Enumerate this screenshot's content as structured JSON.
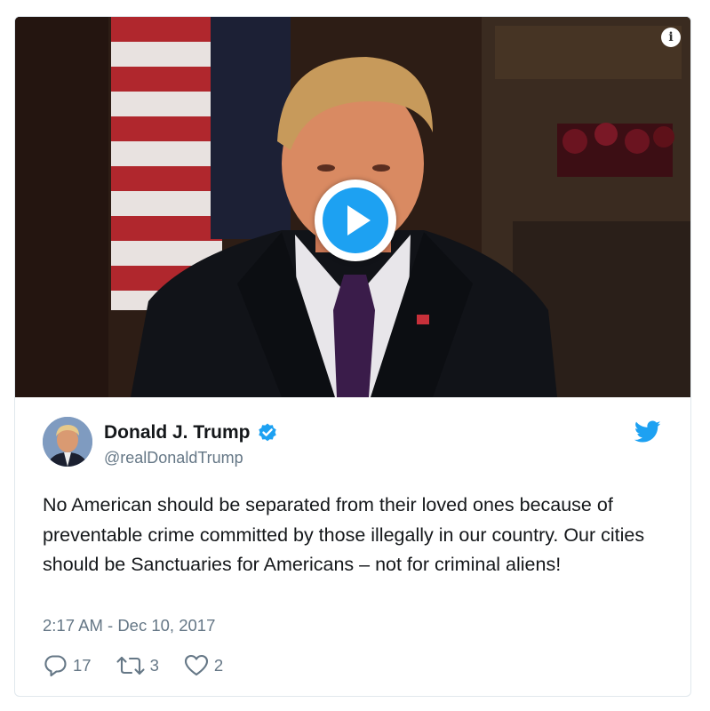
{
  "video": {
    "info_icon": "info-icon",
    "play_icon": "play-icon"
  },
  "author": {
    "name": "Donald J. Trump",
    "handle": "@realDonaldTrump",
    "verified_icon": "verified-badge-icon",
    "verified_color": "#1da1f2"
  },
  "brand": {
    "logo_icon": "twitter-bird-icon",
    "color": "#1da1f2"
  },
  "tweet": {
    "text": "No American should be separated from their loved ones because of preventable crime committed by those illegally in our country. Our cities should be Sanctuaries for Americans – not for criminal aliens!",
    "timestamp": "2:17 AM - Dec 10, 2017"
  },
  "actions": {
    "replies": "17",
    "retweets": "3",
    "likes": "2"
  }
}
